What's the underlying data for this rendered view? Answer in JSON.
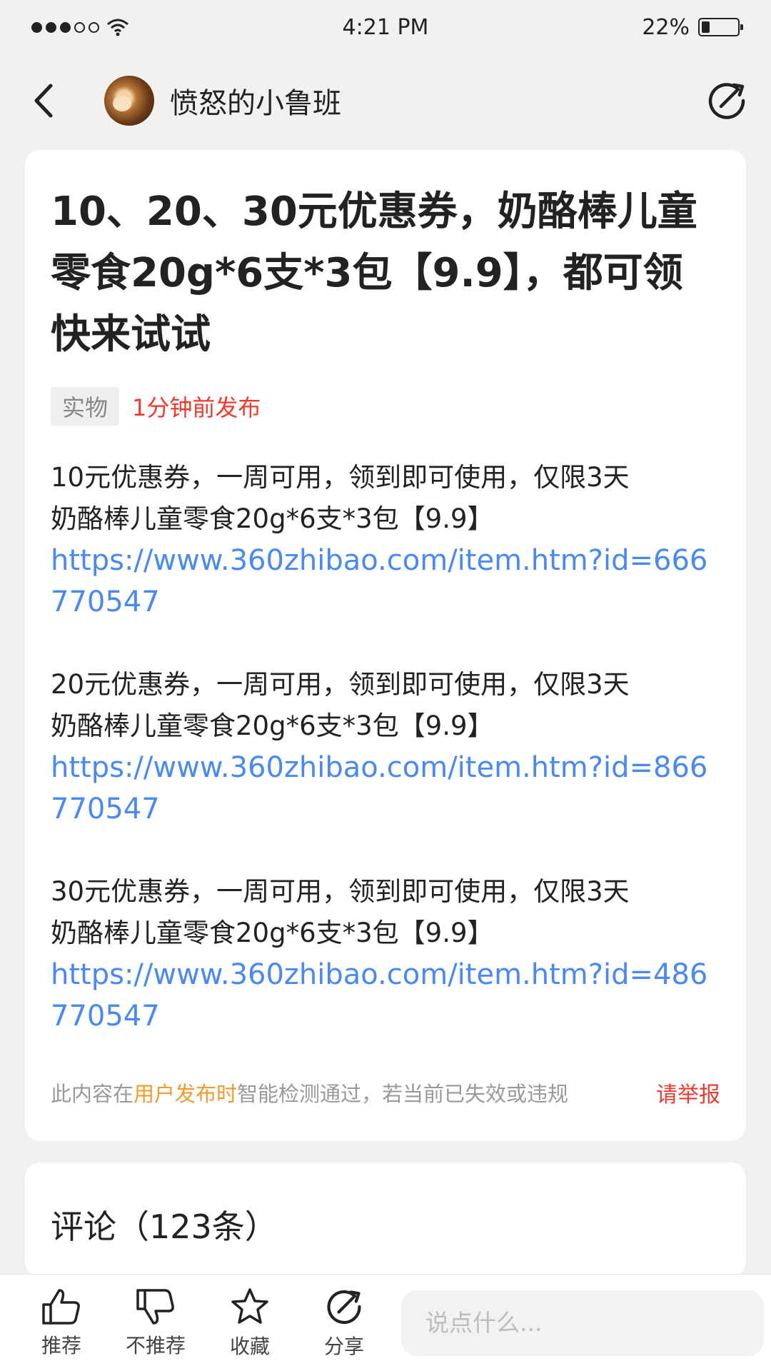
{
  "status_bar": {
    "time": "4:21 PM",
    "battery": "22%",
    "battery_level": 0.22
  },
  "nav": {
    "username": "愤怒的小鲁班"
  },
  "post": {
    "title": "10、20、30元优惠券，奶酪棒儿童零食20g*6支*3包【9.9】，都可领快来试试",
    "tag": "实物",
    "time": "1分钟前发布",
    "blocks": [
      {
        "line1": "10元优惠券，一周可用，领到即可使用，仅限3天",
        "line2": "奶酪棒儿童零食20g*6支*3包【9.9】",
        "link": "https://www.360zhibao.com/item.htm?id=666770547"
      },
      {
        "line1": "20元优惠券，一周可用，领到即可使用，仅限3天",
        "line2": "奶酪棒儿童零食20g*6支*3包【9.9】",
        "link": "https://www.360zhibao.com/item.htm?id=866770547"
      },
      {
        "line1": "30元优惠券，一周可用，领到即可使用，仅限3天",
        "line2": "奶酪棒儿童零食20g*6支*3包【9.9】",
        "link": "https://www.360zhibao.com/item.htm?id=486770547"
      }
    ],
    "footer": {
      "prefix": "此内容在",
      "highlight": "用户发布时",
      "suffix": "智能检测通过，若当前已失效或违规",
      "report": "请举报"
    }
  },
  "comments": {
    "title": "评论（123条）"
  },
  "bottom_bar": {
    "recommend": "推荐",
    "not_recommend": "不推荐",
    "favorite": "收藏",
    "share": "分享",
    "input_placeholder": "说点什么..."
  },
  "colors": {
    "accent_red": "#ee3b2e",
    "link_blue": "#4a8af0",
    "highlight_orange": "#f29a2b"
  }
}
